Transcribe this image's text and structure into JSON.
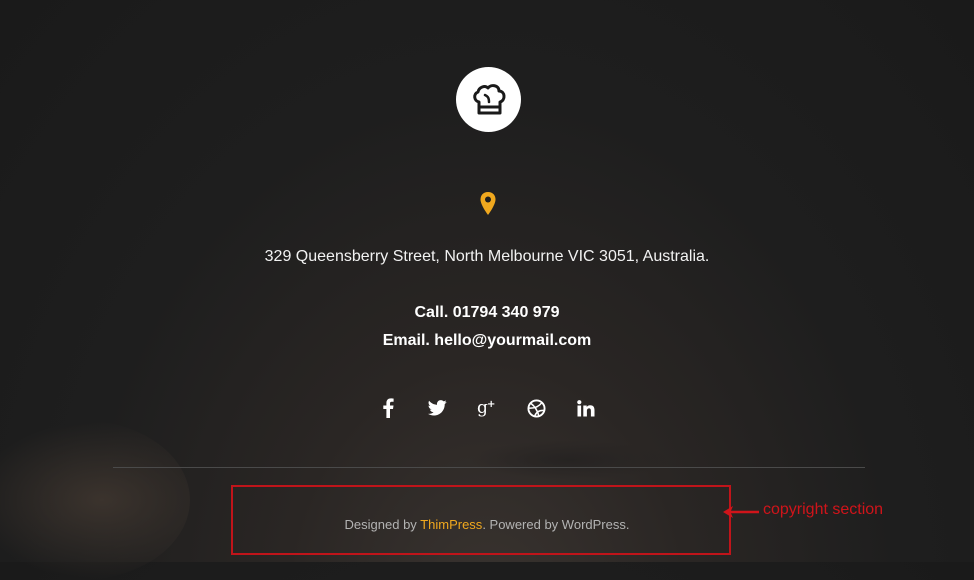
{
  "logo": {
    "icon": "chef-hat-icon",
    "background": "#ffffff"
  },
  "location": {
    "icon": "map-pin-icon",
    "color": "#f0a81e"
  },
  "address": "329 Queensberry Street, North Melbourne VIC 3051, Australia.",
  "contact": {
    "call": "Call. 01794 340 979",
    "email": "Email. hello@yourmail.com"
  },
  "social": [
    {
      "name": "facebook-icon",
      "glyph": "f"
    },
    {
      "name": "twitter-icon",
      "glyph": ""
    },
    {
      "name": "google-plus-icon",
      "glyph": "g+"
    },
    {
      "name": "dribbble-icon",
      "glyph": ""
    },
    {
      "name": "linkedin-icon",
      "glyph": "in"
    }
  ],
  "copyright": {
    "prefix": "Designed by ",
    "brand": "ThimPress",
    "suffix": ". Powered by WordPress.",
    "brand_color": "#f0a81e"
  },
  "annotation": {
    "label": "copyright section",
    "color": "#d0141a"
  }
}
